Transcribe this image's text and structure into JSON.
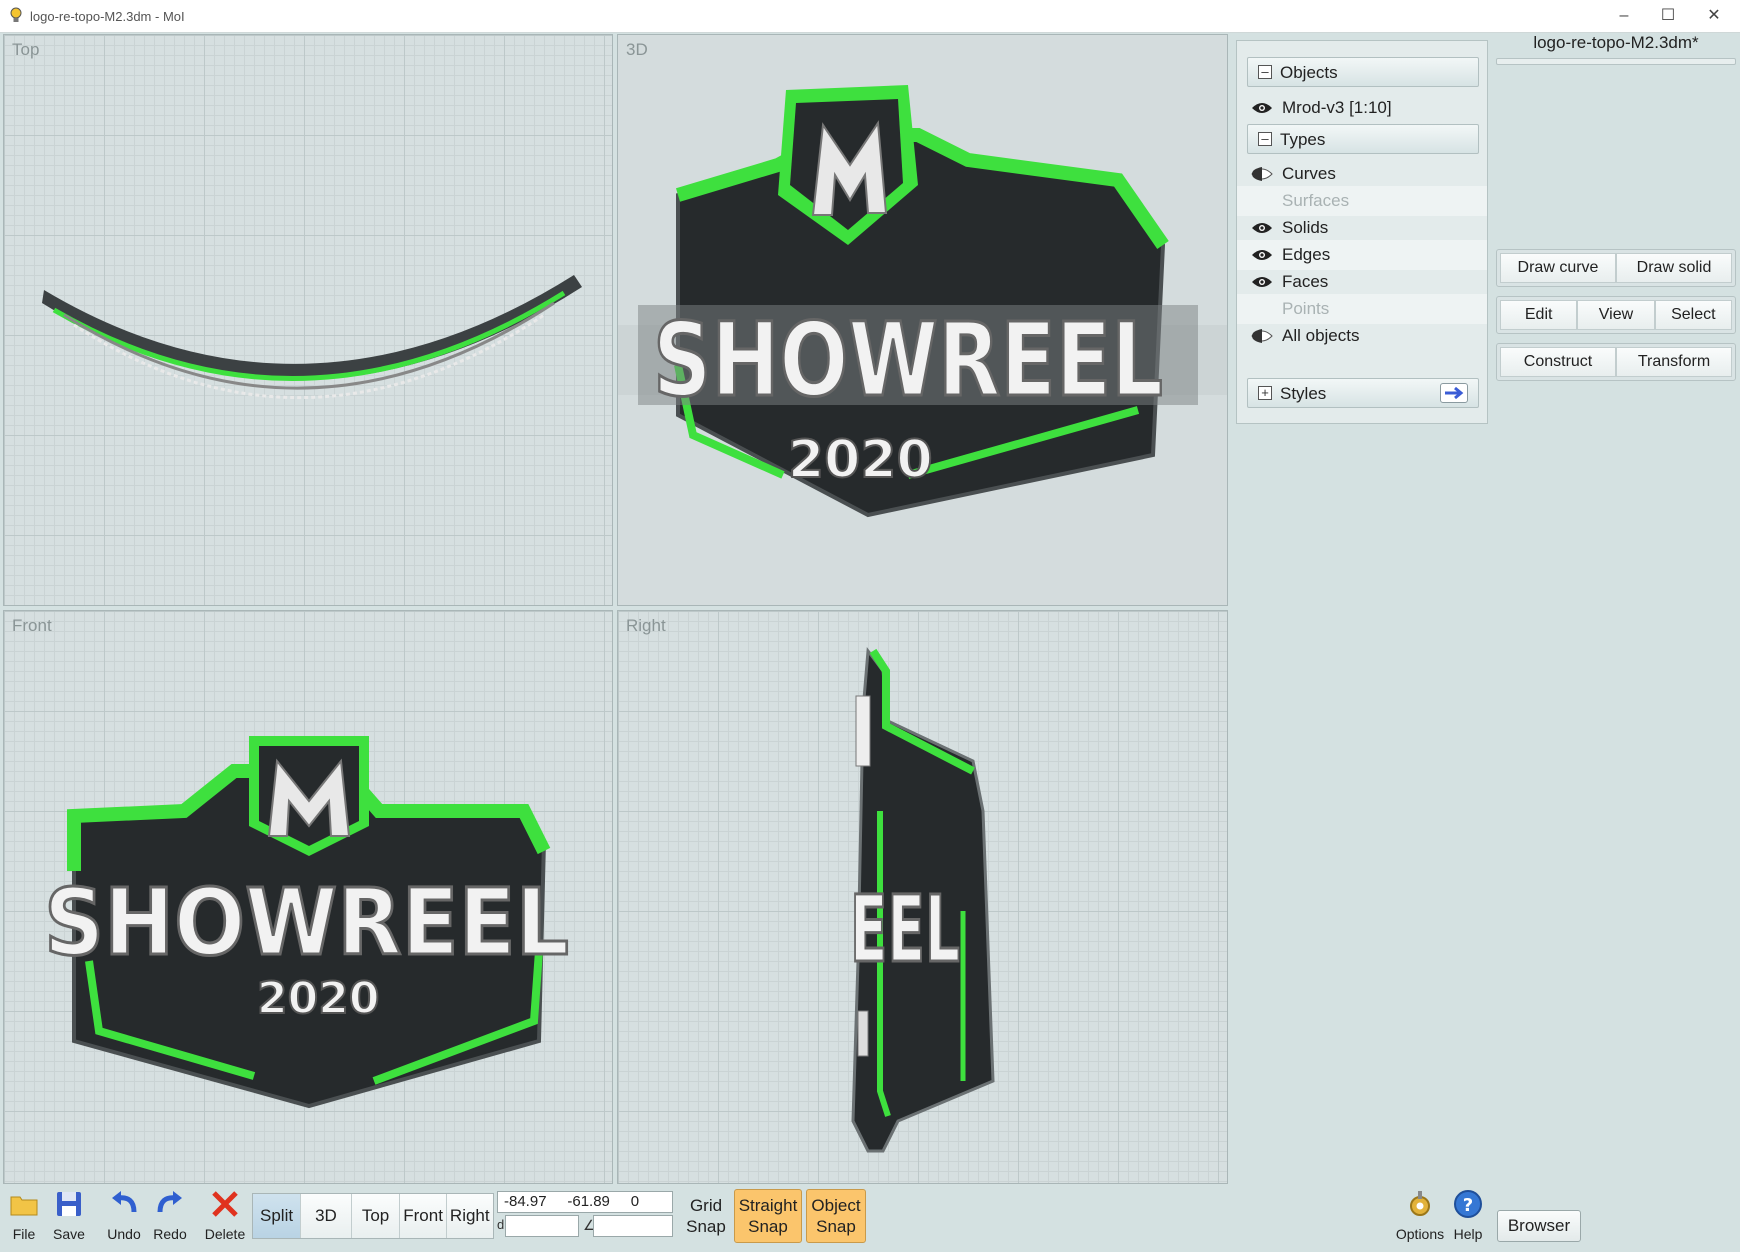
{
  "window": {
    "title": "logo-re-topo-M2.3dm - MoI",
    "controls": [
      "–",
      "☐",
      "✕"
    ]
  },
  "viewports": {
    "top": "Top",
    "persp": "3D",
    "front": "Front",
    "right": "Right"
  },
  "model_text": {
    "main": "SHOWREEL",
    "year": "2020",
    "partial": "EEL",
    "monogram": "M"
  },
  "accent_colors": {
    "green": "#3ee03e",
    "dark": "#262a2c",
    "snap_on": "#fbc56c"
  },
  "scene_panel": {
    "objects_header": "Objects",
    "object_item": "Mrod-v3 [1:10]",
    "types_header": "Types",
    "types": [
      {
        "label": "Curves",
        "eye": "half"
      },
      {
        "label": "Surfaces",
        "eye": "none"
      },
      {
        "label": "Solids",
        "eye": "full"
      },
      {
        "label": "Edges",
        "eye": "full"
      },
      {
        "label": "Faces",
        "eye": "full"
      },
      {
        "label": "Points",
        "eye": "none"
      },
      {
        "label": "All objects",
        "eye": "half"
      }
    ],
    "styles_header": "Styles",
    "collapse_symbol": "–",
    "expand_symbol": "+"
  },
  "document": {
    "name": "logo-re-topo-M2.3dm*"
  },
  "command_buttons": {
    "draw_curve": "Draw curve",
    "draw_solid": "Draw solid",
    "edit": "Edit",
    "view": "View",
    "select": "Select",
    "construct": "Construct",
    "transform": "Transform"
  },
  "bottom_toolbar": {
    "file": "File",
    "save": "Save",
    "undo": "Undo",
    "redo": "Redo",
    "delete": "Delete",
    "views": [
      "Split",
      "3D",
      "Top",
      "Front",
      "Right"
    ],
    "active_view": "Split",
    "coord_display": "-84.97     -61.89     0",
    "distance_label": "d",
    "angle_label": "∠",
    "distance_value": "",
    "angle_value": "",
    "grid_snap": [
      "Grid",
      "Snap"
    ],
    "straight_snap": [
      "Straight",
      "Snap"
    ],
    "object_snap": [
      "Object",
      "Snap"
    ],
    "options": "Options",
    "help": "Help",
    "browser": "Browser"
  }
}
